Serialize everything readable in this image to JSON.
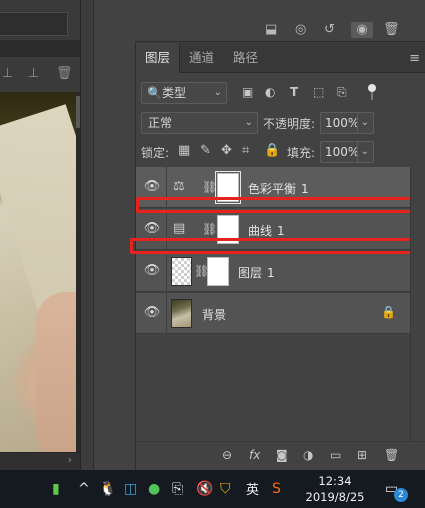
{
  "panel": {
    "tabs": [
      "图层",
      "通道",
      "路径"
    ],
    "menu_icon": "hamburger-icon"
  },
  "filter": {
    "kind_label": "类型",
    "icons": [
      "image-filter-icon",
      "adjustment-filter-icon",
      "text-filter-icon",
      "shape-filter-icon",
      "smart-object-filter-icon",
      "filter-toggle-icon"
    ]
  },
  "blend": {
    "mode": "正常",
    "opacity_label": "不透明度:",
    "opacity_value": "100%"
  },
  "lock": {
    "label": "锁定:",
    "icons": [
      "lock-transparent-icon",
      "lock-image-icon",
      "lock-position-icon",
      "lock-artboard-icon",
      "lock-all-icon"
    ],
    "fill_label": "填充:",
    "fill_value": "100%"
  },
  "layers": [
    {
      "name": "色彩平衡",
      "suffix": "1",
      "type": "color-balance-adjustment",
      "selected": true
    },
    {
      "name": "曲线",
      "suffix": "1",
      "type": "curves-adjustment",
      "selected": false
    },
    {
      "name": "图层",
      "suffix": "1",
      "type": "pixel-layer",
      "selected": false
    },
    {
      "name": "背景",
      "suffix": "",
      "type": "background",
      "locked": true,
      "selected": false
    }
  ],
  "bottom_icons": [
    "link-layers-icon",
    "fx-icon",
    "add-mask-icon",
    "adjustment-layer-icon",
    "group-folder-icon",
    "new-layer-icon",
    "trash-icon"
  ],
  "taskbar": {
    "time": "12:34",
    "date": "2019/8/25",
    "ime": "英",
    "notification_count": "2"
  },
  "colors": {
    "highlight_red": "#e8231d",
    "panel_bg": "#424242",
    "taskbar_bg": "#141a20"
  }
}
